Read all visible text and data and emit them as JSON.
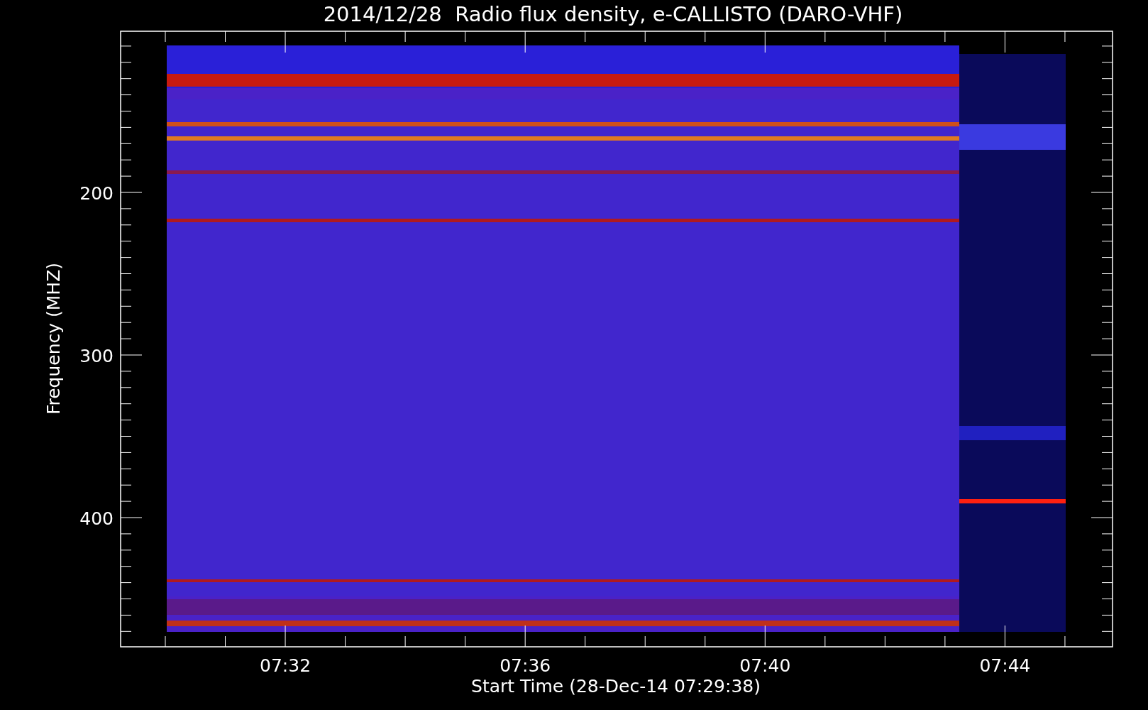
{
  "title": "2014/12/28  Radio flux density, e-CALLISTO (DARO-VHF)",
  "y_axis": {
    "label": "Frequency (MHZ)",
    "tick_labels": [
      "200",
      "300",
      "400"
    ]
  },
  "x_axis": {
    "label": "Start Time (28-Dec-14 07:29:38)",
    "tick_labels": [
      "07:32",
      "07:36",
      "07:40",
      "07:44"
    ]
  }
}
